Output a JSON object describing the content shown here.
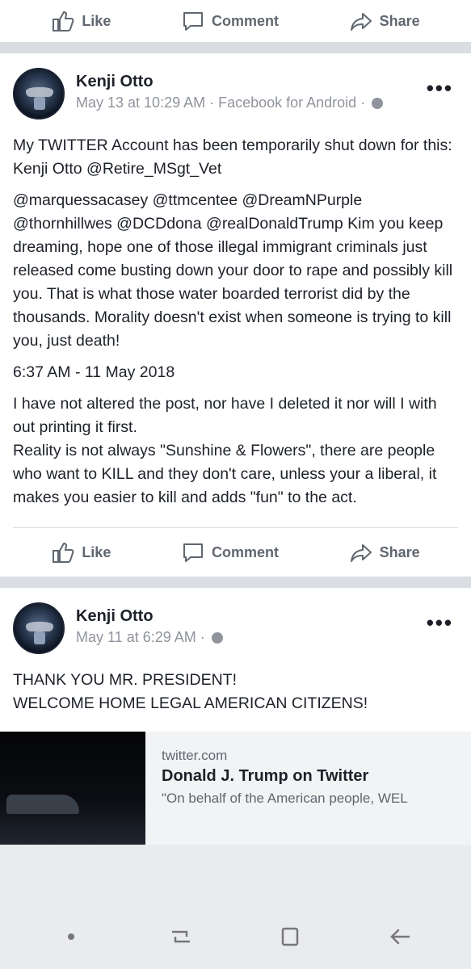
{
  "top_actions": {
    "like": "Like",
    "comment": "Comment",
    "share": "Share"
  },
  "post1": {
    "author": "Kenji Otto",
    "timestamp": "May 13 at 10:29 AM · Facebook for Android ·",
    "paragraphs": [
      "My TWITTER Account has been temporarily shut down for this:",
      "Kenji Otto @Retire_MSgt_Vet",
      "@marquessacasey @ttmcentee @DreamNPurple @thornhillwes @DCDdona @realDonaldTrump Kim you keep dreaming, hope one of those illegal immigrant criminals just released come busting down your door to rape and possibly kill you. That is what those water boarded terrorist did by the thousands. Morality doesn't exist when someone is trying to kill you, just death!",
      "6:37 AM - 11 May 2018",
      "I have not altered the post, nor have I deleted it nor will I with out printing it first.",
      "Reality is not always \"Sunshine & Flowers\", there are people who want to KILL and they don't care, unless your a liberal, it makes you easier to kill and adds \"fun\" to the act."
    ],
    "actions": {
      "like": "Like",
      "comment": "Comment",
      "share": "Share"
    }
  },
  "post2": {
    "author": "Kenji Otto",
    "timestamp": "May 11 at 6:29 AM ·",
    "line1": "THANK YOU MR. PRESIDENT!",
    "line2": "WELCOME HOME LEGAL AMERICAN CITIZENS!",
    "link": {
      "domain": "twitter.com",
      "title": "Donald J. Trump on Twitter",
      "description": "\"On behalf of the American people, WEL"
    }
  },
  "icons": {
    "like": "thumbs-up-icon",
    "comment": "comment-bubble-icon",
    "share": "share-arrow-icon",
    "more": "more-dots-icon",
    "globe": "globe-icon",
    "nav_dot": "dot-icon",
    "nav_recent": "recent-apps-icon",
    "nav_home": "home-icon",
    "nav_back": "back-icon"
  }
}
